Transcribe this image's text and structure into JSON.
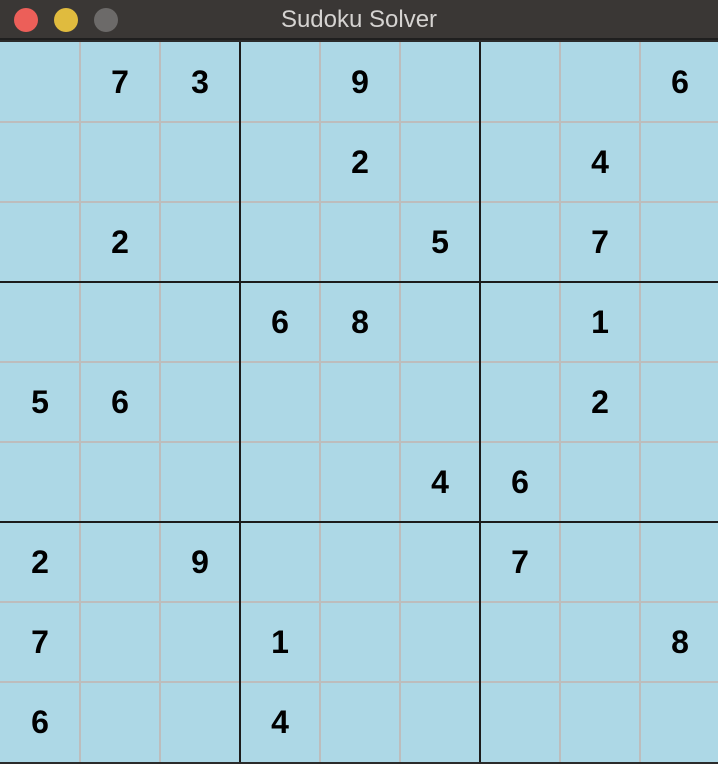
{
  "window": {
    "title": "Sudoku Solver"
  },
  "board": {
    "size": 9,
    "cells": [
      [
        "",
        "7",
        "3",
        "",
        "9",
        "",
        "",
        "",
        "6"
      ],
      [
        "",
        "",
        "",
        "",
        "2",
        "",
        "",
        "4",
        ""
      ],
      [
        "",
        "2",
        "",
        "",
        "",
        "5",
        "",
        "7",
        ""
      ],
      [
        "",
        "",
        "",
        "6",
        "8",
        "",
        "",
        "1",
        ""
      ],
      [
        "5",
        "6",
        "",
        "",
        "",
        "",
        "",
        "2",
        ""
      ],
      [
        "",
        "",
        "",
        "",
        "",
        "4",
        "6",
        "",
        ""
      ],
      [
        "2",
        "",
        "9",
        "",
        "",
        "",
        "7",
        "",
        ""
      ],
      [
        "7",
        "",
        "",
        "1",
        "",
        "",
        "",
        "",
        "8"
      ],
      [
        "6",
        "",
        "",
        "4",
        "",
        "",
        "",
        "",
        ""
      ]
    ]
  },
  "colors": {
    "board_background": "#add8e6",
    "thin_line": "#bdbdbd",
    "thick_line": "#1c1c1c",
    "digit": "#000000"
  }
}
